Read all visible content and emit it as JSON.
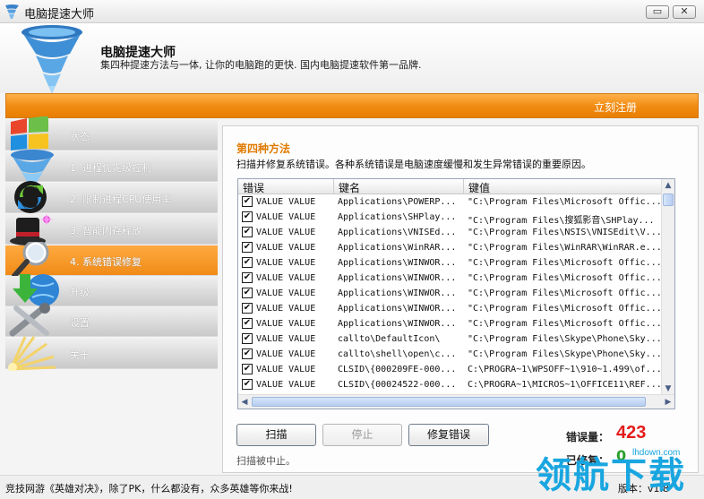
{
  "window": {
    "title": "电脑提速大师",
    "minimize_glyph": "▭",
    "close_glyph": "✕"
  },
  "header": {
    "app_name": "电脑提速大师",
    "slogan": "集四种提速方法与一体, 让你的电脑跑的更快. 国内电脑提速软件第一品牌."
  },
  "topbar": {
    "register_label": "立刻注册"
  },
  "sidebar": {
    "items": [
      {
        "label": "状态",
        "icon": "windows-logo-icon",
        "active": false
      },
      {
        "label": "1. 进程优先级控制",
        "icon": "tornado-icon",
        "active": false
      },
      {
        "label": "2. 限制进程CPU使用率",
        "icon": "refresh-arrows-icon",
        "active": false
      },
      {
        "label": "3. 智能内存释放",
        "icon": "magic-hat-icon",
        "active": false
      },
      {
        "label": "4. 系统错误修复",
        "icon": "magnifier-icon",
        "active": true
      },
      {
        "label": "升级",
        "icon": "globe-download-icon",
        "active": false
      },
      {
        "label": "设置",
        "icon": "tools-icon",
        "active": false
      },
      {
        "label": "关于",
        "icon": "light-burst-icon",
        "active": false
      }
    ]
  },
  "main": {
    "method_title": "第四种方法",
    "method_description": "扫描并修复系统错误。各种系统错误是电脑速度缓慢和发生异常错误的重要原因。",
    "columns": [
      "错误",
      "键名",
      "键值"
    ],
    "rows": [
      {
        "error": "VALUE VALUE",
        "key": "Applications\\POWERP...",
        "value": "\"C:\\Program Files\\Microsoft Offic..."
      },
      {
        "error": "VALUE VALUE",
        "key": "Applications\\SHPlay...",
        "value": "\"C:\\Program Files\\搜狐影音\\SHPlay..."
      },
      {
        "error": "VALUE VALUE",
        "key": "Applications\\VNISEd...",
        "value": "\"C:\\Program Files\\NSIS\\VNISEdit\\V..."
      },
      {
        "error": "VALUE VALUE",
        "key": "Applications\\WinRAR...",
        "value": "\"C:\\Program Files\\WinRAR\\WinRAR.e..."
      },
      {
        "error": "VALUE VALUE",
        "key": "Applications\\WINWOR...",
        "value": "\"C:\\Program Files\\Microsoft Offic..."
      },
      {
        "error": "VALUE VALUE",
        "key": "Applications\\WINWOR...",
        "value": "\"C:\\Program Files\\Microsoft Offic..."
      },
      {
        "error": "VALUE VALUE",
        "key": "Applications\\WINWOR...",
        "value": "\"C:\\Program Files\\Microsoft Offic..."
      },
      {
        "error": "VALUE VALUE",
        "key": "Applications\\WINWOR...",
        "value": "\"C:\\Program Files\\Microsoft Offic..."
      },
      {
        "error": "VALUE VALUE",
        "key": "Applications\\WINWOR...",
        "value": "\"C:\\Program Files\\Microsoft Offic..."
      },
      {
        "error": "VALUE VALUE",
        "key": "callto\\DefaultIcon\\",
        "value": "\"C:\\Program Files\\Skype\\Phone\\Sky..."
      },
      {
        "error": "VALUE VALUE",
        "key": "callto\\shell\\open\\c...",
        "value": "\"C:\\Program Files\\Skype\\Phone\\Sky..."
      },
      {
        "error": "VALUE VALUE",
        "key": "CLSID\\{000209FE-000...",
        "value": "C:\\PROGRA~1\\WPSOFF~1\\910~1.499\\of..."
      },
      {
        "error": "VALUE VALUE",
        "key": "CLSID\\{00024522-000...",
        "value": "C:\\PROGRA~1\\MICROS~1\\OFFICE11\\REF..."
      }
    ],
    "checkbox_glyph": "✔",
    "scroll_up": "▲",
    "scroll_down": "▼",
    "scroll_left": "◀",
    "scroll_right": "▶",
    "buttons": {
      "scan": "扫描",
      "stop": "停止",
      "fix": "修复错误"
    },
    "status": "扫描被中止。",
    "error_count_label": "错误量：",
    "error_count": "423",
    "fixed_count_label": "已修复：",
    "fixed_count": "0"
  },
  "footer": {
    "promo": "竞技网游《英雄对决》，除了PK，什么都没有，众多英雄等你来战!",
    "version": "版本：v1.8"
  },
  "watermark": {
    "text": "领航下载",
    "url": "lhdown.com"
  },
  "colors": {
    "accent": "#f08c18",
    "error_count": "#e41b1b",
    "link": "#ffffff"
  }
}
